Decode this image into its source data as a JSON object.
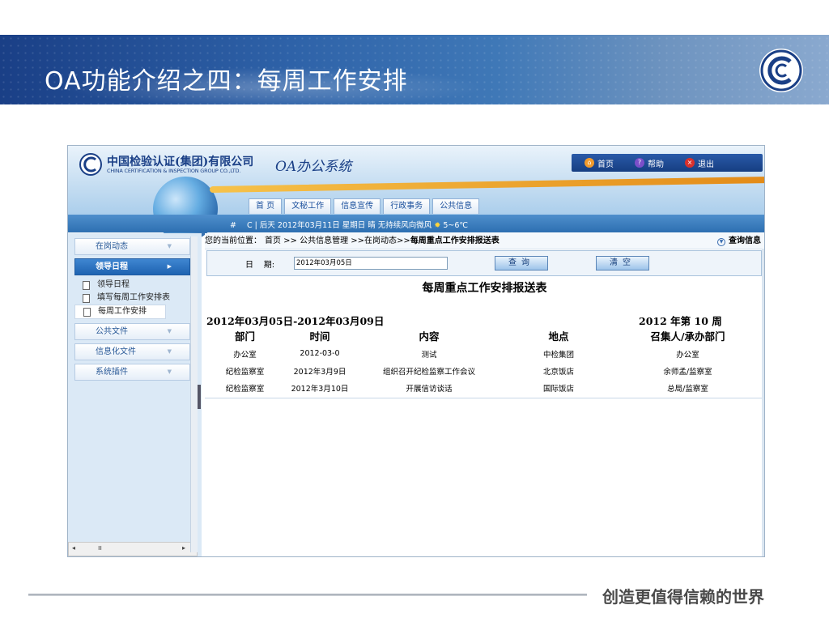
{
  "slide": {
    "title": "OA功能介绍之四：每周工作安排",
    "footer_slogan": "创造更值得信赖的世界",
    "logo_icon": "cic-logo"
  },
  "header": {
    "company_name_cn": "中国检验认证(集团)有限公司",
    "company_name_en": "CHINA CERTIFICATION & INSPECTION GROUP CO.,LTD.",
    "system_title": "OA办公系统",
    "top_links": [
      {
        "label": "首页",
        "icon": "home-icon"
      },
      {
        "label": "帮助",
        "icon": "help-icon"
      },
      {
        "label": "退出",
        "icon": "exit-icon"
      }
    ]
  },
  "nav_tabs": [
    "首 页",
    "文秘工作",
    "信息宣传",
    "行政事务",
    "公共信息"
  ],
  "status_line": {
    "hash": "#",
    "text": "C | 后天 2012年03月11日 星期日 晴 无持续风向微风",
    "temp": "5~6℃"
  },
  "sidebar": {
    "menus_top": [
      {
        "label": "在岗动态",
        "active": false
      },
      {
        "label": "领导日程",
        "active": true
      }
    ],
    "sub_items": [
      {
        "label": "领导日程",
        "current": false
      },
      {
        "label": "填写每周工作安排表",
        "current": false
      },
      {
        "label": "每周工作安排",
        "current": true
      }
    ],
    "menus_bottom": [
      {
        "label": "公共文件"
      },
      {
        "label": "信息化文件"
      },
      {
        "label": "系统插件"
      }
    ],
    "scroll_grip": "Ⅲ"
  },
  "breadcrumb": {
    "prefix": "您的当前位置：",
    "path": "首页 >> 公共信息管理 >>在岗动态>>",
    "current": "每周重点工作安排报送表",
    "query_info": "查询信息"
  },
  "search": {
    "date_label": "日    期:",
    "date_value": "2012年03月05日",
    "query_button": "查询",
    "clear_button": "清空"
  },
  "report": {
    "title": "每周重点工作安排报送表",
    "date_range": "2012年03月05日-2012年03月09日",
    "week_label": "2012 年第 10 周",
    "columns": [
      "部门",
      "时间",
      "内容",
      "地点",
      "召集人/承办部门"
    ],
    "rows": [
      [
        "办公室",
        "2012-03-0",
        "测试",
        "中检集团",
        "办公室"
      ],
      [
        "纪检监察室",
        "2012年3月9日",
        "组织召开纪检监察工作会议",
        "北京饭店",
        "余师孟/监察室"
      ],
      [
        "纪检监察室",
        "2012年3月10日",
        "开展信访谈话",
        "国际饭店",
        "总局/监察室"
      ]
    ]
  }
}
